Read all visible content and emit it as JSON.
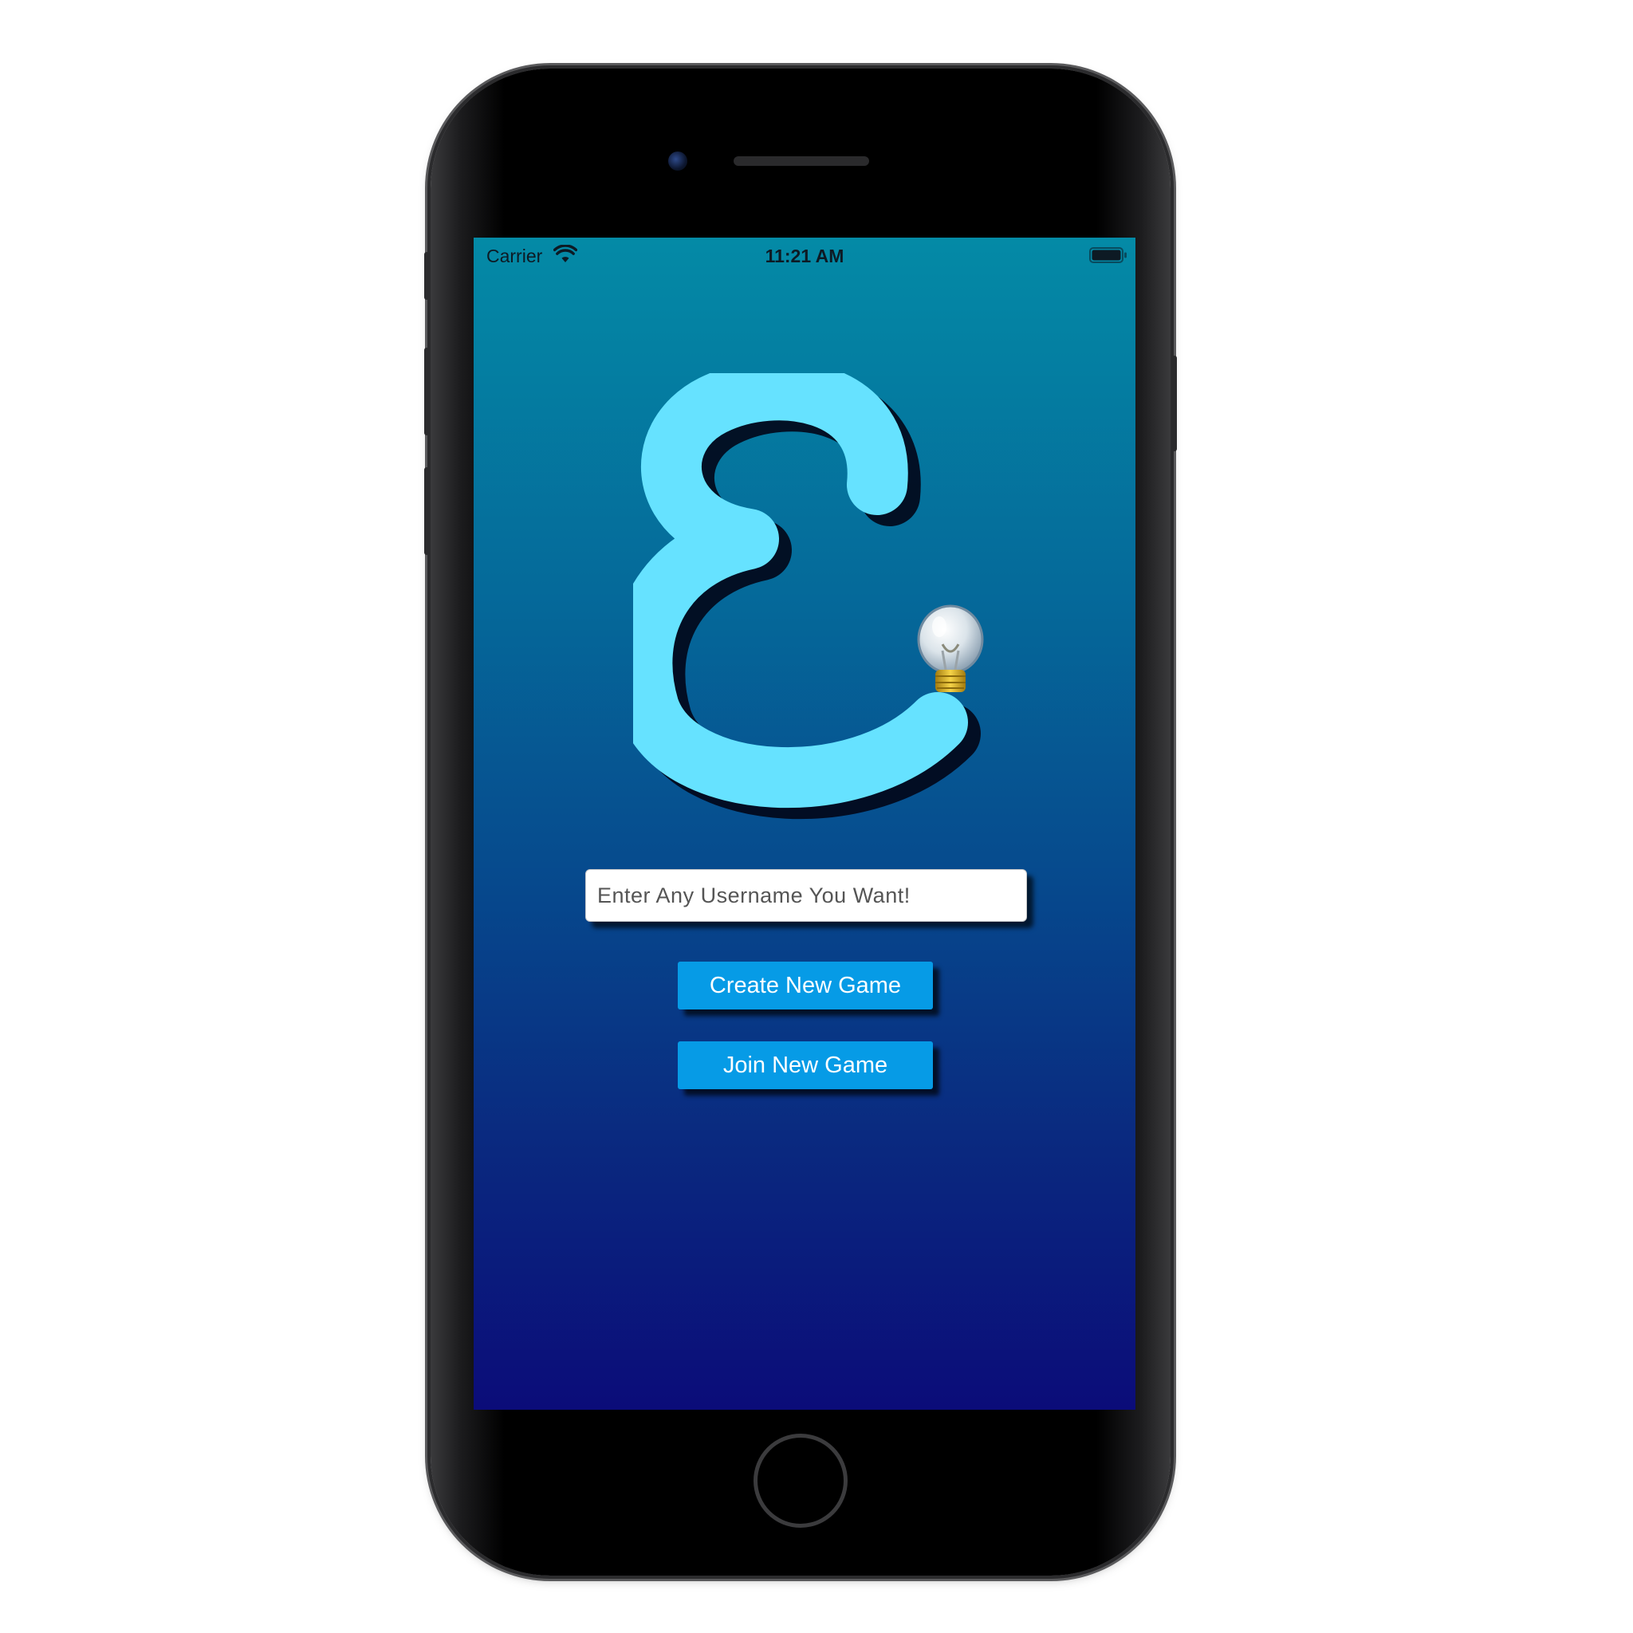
{
  "status_bar": {
    "carrier": "Carrier",
    "time": "11:21 AM",
    "wifi_icon": "wifi-icon",
    "battery_icon": "battery-icon"
  },
  "logo": {
    "icon": "epsilon-lightbulb-logo",
    "glyph_color": "#66e2ff"
  },
  "username": {
    "placeholder": "Enter Any Username You Want!",
    "value": ""
  },
  "buttons": {
    "create_label": "Create New Game",
    "join_label": "Join New Game",
    "color": "#069be6"
  },
  "theme": {
    "gradient_top": "#048aa6",
    "gradient_bottom": "#0b0c79"
  }
}
